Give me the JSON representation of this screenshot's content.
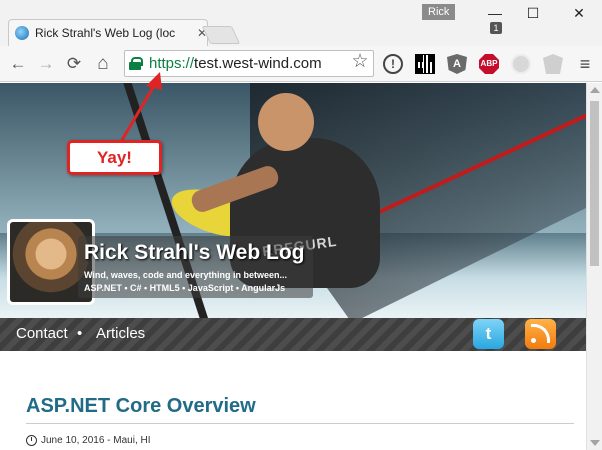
{
  "browser": {
    "tab_title": "Rick Strahl's Web Log (loc",
    "tab_close": "✕",
    "user_name": "Rick",
    "window_controls": {
      "minimize": "—",
      "maximize": "☐",
      "close": "✕"
    },
    "toolbar": {
      "back": "←",
      "forward": "→",
      "reload": "⟳",
      "home": "⌂",
      "url_scheme": "https://",
      "url_host": "test.west-wind.com",
      "bookmark_star": "☆",
      "extensions": {
        "info": "!",
        "angular": "A",
        "abp": "ABP",
        "abp_count": "1"
      },
      "menu": "≡"
    }
  },
  "page": {
    "hero": {
      "wetsuit_text": "RRFGURL"
    },
    "site_title": "Rick Strahl's Web Log",
    "site_subtitle": "Wind, waves, code and everything in between...",
    "site_tech": "ASP.NET • C# • HTML5 • JavaScript • AngularJs",
    "nav": {
      "contact": "Contact",
      "separator": "•",
      "articles": "Articles"
    },
    "social": {
      "twitter": "t"
    },
    "post": {
      "title": "ASP.NET Core Overview",
      "meta": "June 10, 2016 - Maui, HI"
    }
  },
  "annotation": {
    "text": "Yay!",
    "color": "#e02424"
  },
  "colors": {
    "secure_green": "#0b8043",
    "post_title": "#216b87"
  }
}
